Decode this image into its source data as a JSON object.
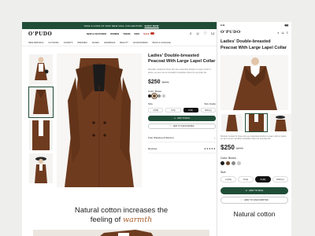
{
  "brand": {
    "logo": "O'PUDO",
    "accent": "#1f4d37",
    "coat": "#6e3b1f"
  },
  "promo": {
    "text": "TAKE A LOOK AT OUR NEW FALL COLLECTION",
    "link": "SHOP NOW"
  },
  "main_nav": [
    "NEW & FEATURED",
    "WOMEN",
    "TEENS",
    "KIDS",
    "SALE"
  ],
  "category_nav": [
    "NEW ARRIVALS",
    "CLOTHING",
    "JACKETS",
    "DRESSES",
    "SHOES",
    "HANDBAGS",
    "BEAUTY",
    "ACCESSORIES",
    "BAGS & LUGGAGE"
  ],
  "product": {
    "title": "Ladies' Double-breasted Peacoat With Large Lapel Collar",
    "description": "Shoulder models for those who are undecided whether to wear a shirt or jacket, we see it as an incredibly irresistible choice for everyday life.",
    "price": "$250",
    "old_price": "$275",
    "color_label": "Color: Brown",
    "colors": [
      "#1b1b1b",
      "#6b4a2b",
      "#8b8b8b",
      "#c7c7c7"
    ],
    "size_label": "Size",
    "size_guide": "Size Guide",
    "sizes": [
      "4 (XS)",
      "6 (S)",
      "8 (M)",
      "8/10 (L)"
    ],
    "selected_size": "8 (M)",
    "add_to_bag": "ADD TO BAG",
    "add_to_favourites": "ADD TO FAVOURITES",
    "shipping_label": "Free Shipping & Returns",
    "reviews_label": "Reviews",
    "rating_stars": "★★★★★"
  },
  "tagline": {
    "line1": "Natural cotton increases the",
    "line2_plain": "feeling of",
    "line2_italic": "warmth"
  },
  "mobile": {
    "time": "9:41",
    "price": "$250",
    "old_price": "$275",
    "color_label": "Color: Brown",
    "size_label": "Size",
    "sizes": [
      "4 (XS)",
      "6 (S)",
      "8 (M)",
      "8/10 (L)"
    ],
    "add_to_bag": "ADD TO BAG",
    "add_to_favourites": "ADD TO FAVOURITES",
    "tagline": "Natural cotton"
  }
}
